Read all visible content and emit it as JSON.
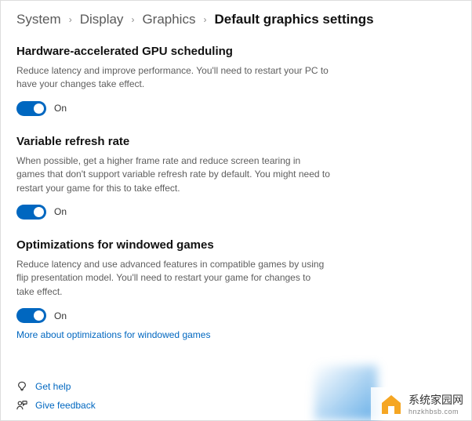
{
  "breadcrumb": {
    "items": [
      "System",
      "Display",
      "Graphics"
    ],
    "current": "Default graphics settings"
  },
  "sections": [
    {
      "title": "Hardware-accelerated GPU scheduling",
      "desc": "Reduce latency and improve performance. You'll need to restart your PC to have your changes take effect.",
      "toggle_state": "On"
    },
    {
      "title": "Variable refresh rate",
      "desc": "When possible, get a higher frame rate and reduce screen tearing in games that don't support variable refresh rate by default. You might need to restart your game for this to take effect.",
      "toggle_state": "On"
    },
    {
      "title": "Optimizations for windowed games",
      "desc": "Reduce latency and use advanced features in compatible games by using flip presentation model. You'll need to restart your game for changes to take effect.",
      "toggle_state": "On",
      "link": "More about optimizations for windowed games"
    }
  ],
  "footer": {
    "help": "Get help",
    "feedback": "Give feedback"
  },
  "watermark": {
    "text": "系统家园网",
    "sub": "hnzkhbsb.com"
  },
  "colors": {
    "accent": "#0067c0"
  }
}
